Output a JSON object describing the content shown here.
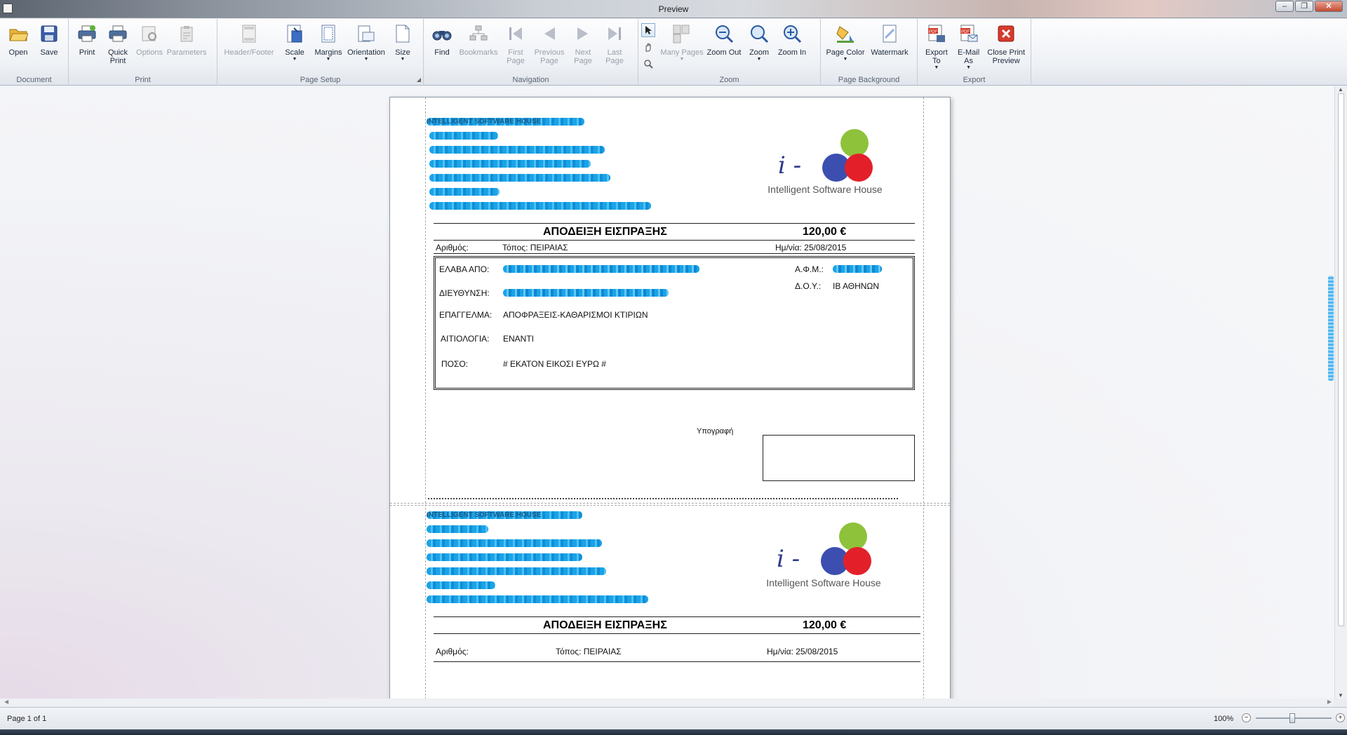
{
  "window": {
    "title": "Preview"
  },
  "ribbon": {
    "groups": [
      {
        "caption": "Document",
        "buttons": [
          {
            "label": "Open",
            "icon": "folder-open-icon",
            "enabled": true
          },
          {
            "label": "Save",
            "icon": "save-disk-icon",
            "enabled": true
          }
        ]
      },
      {
        "caption": "Print",
        "buttons": [
          {
            "label": "Print",
            "icon": "printer-icon",
            "enabled": true
          },
          {
            "label": "Quick\nPrint",
            "icon": "quick-printer-icon",
            "enabled": true
          },
          {
            "label": "Options",
            "icon": "print-options-icon",
            "enabled": false
          },
          {
            "label": "Parameters",
            "icon": "parameters-icon",
            "enabled": false
          }
        ]
      },
      {
        "caption": "Page Setup",
        "buttons": [
          {
            "label": "Header/Footer",
            "icon": "header-footer-icon",
            "enabled": false
          },
          {
            "label": "Scale",
            "icon": "scale-icon",
            "enabled": true,
            "dropdown": true
          },
          {
            "label": "Margins",
            "icon": "margins-icon",
            "enabled": true,
            "dropdown": true
          },
          {
            "label": "Orientation",
            "icon": "orientation-icon",
            "enabled": true,
            "dropdown": true
          },
          {
            "label": "Size",
            "icon": "page-size-icon",
            "enabled": true,
            "dropdown": true
          }
        ]
      },
      {
        "caption": "Navigation",
        "buttons": [
          {
            "label": "Find",
            "icon": "binoculars-icon",
            "enabled": true
          },
          {
            "label": "Bookmarks",
            "icon": "bookmarks-icon",
            "enabled": false
          },
          {
            "label": "First\nPage",
            "icon": "first-page-icon",
            "enabled": false
          },
          {
            "label": "Previous\nPage",
            "icon": "previous-page-icon",
            "enabled": false
          },
          {
            "label": "Next\nPage",
            "icon": "next-page-icon",
            "enabled": false
          },
          {
            "label": "Last\nPage",
            "icon": "last-page-icon",
            "enabled": false
          }
        ]
      },
      {
        "caption": "Zoom",
        "buttons": [
          {
            "label": "Many Pages",
            "icon": "many-pages-icon",
            "enabled": false,
            "dropdown": true
          },
          {
            "label": "Zoom Out",
            "icon": "zoom-out-icon",
            "enabled": true
          },
          {
            "label": "Zoom",
            "icon": "zoom-icon",
            "enabled": true,
            "dropdown": true
          },
          {
            "label": "Zoom In",
            "icon": "zoom-in-icon",
            "enabled": true
          }
        ]
      },
      {
        "caption": "Page Background",
        "buttons": [
          {
            "label": "Page Color",
            "icon": "page-color-icon",
            "enabled": true,
            "dropdown": true
          },
          {
            "label": "Watermark",
            "icon": "watermark-icon",
            "enabled": true
          }
        ]
      },
      {
        "caption": "Export",
        "buttons": [
          {
            "label": "Export\nTo",
            "icon": "export-pdf-icon",
            "enabled": true,
            "dropdown": true
          },
          {
            "label": "E-Mail\nAs",
            "icon": "email-pdf-icon",
            "enabled": true,
            "dropdown": true
          },
          {
            "label": "Close Print\nPreview",
            "icon": "close-preview-icon",
            "enabled": true
          }
        ]
      }
    ]
  },
  "receipt": {
    "company_name": "INTELLIGENT SOFTWARE HOUSE",
    "logo_letter": "i -",
    "logo_name": "Intelligent Software House",
    "title": "ΑΠΟΔΕΙΞΗ ΕΙΣΠΡΑΞΗΣ",
    "amount": "120,00 €",
    "number_label": "Αριθμός:",
    "place": "Τόπος: ΠΕΙΡΑΙΑΣ",
    "date": "Ημ/νία: 25/08/2015",
    "fields": {
      "received_from_label": "ΕΛΑΒΑ ΑΠΟ:",
      "address_label": "ΔΙΕΥΘΥΝΣΗ:",
      "profession_label": "ΕΠΑΓΓΕΛΜΑ:",
      "profession_value": "ΑΠΟΦΡΑΞΕΙΣ-ΚΑΘΑΡΙΣΜΟΙ ΚΤΙΡΙΩΝ",
      "reason_label": "ΑΙΤΙΟΛΟΓΙΑ:",
      "reason_value": "ΕΝΑΝΤΙ",
      "amount_label": "ΠΟΣΟ:",
      "amount_words": "# ΕΚΑΤΟΝ ΕΙΚΟΣΙ  ΕΥΡΩ #",
      "afm_label": "Α.Φ.Μ.:",
      "doy_label": "Δ.Ο.Υ.:",
      "doy_value": "ΙΒ ΑΘΗΝΩΝ"
    },
    "signature_label": "Υπογραφή"
  },
  "statusbar": {
    "page_info": "Page 1 of 1",
    "zoom": "100%"
  },
  "colors": {
    "redaction_blue": "#1aa3e8",
    "logo_green": "#8fc23b",
    "logo_blue": "#3c4fb0",
    "logo_red": "#e3202a"
  }
}
